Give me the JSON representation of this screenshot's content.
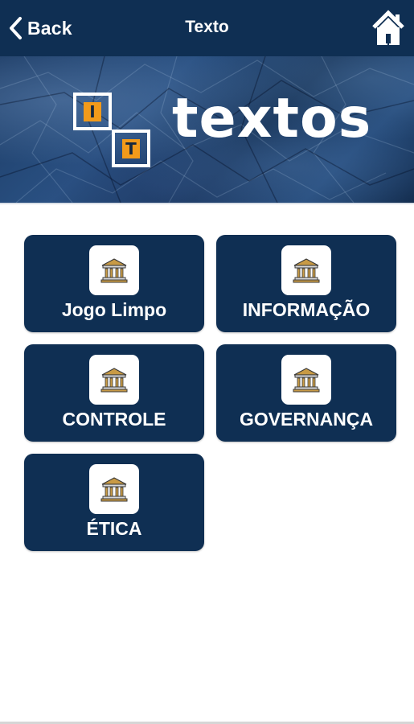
{
  "header": {
    "back_label": "Back",
    "title": "Texto",
    "back_icon": "chevron-left-icon",
    "home_icon": "home-icon"
  },
  "banner": {
    "logo_letters": [
      "I",
      "T"
    ],
    "text": "textos"
  },
  "tiles": [
    {
      "label": "Jogo Limpo",
      "icon": "bank-icon"
    },
    {
      "label": "INFORMAÇÃO",
      "icon": "bank-icon"
    },
    {
      "label": "CONTROLE",
      "icon": "bank-icon"
    },
    {
      "label": "GOVERNANÇA",
      "icon": "bank-icon"
    },
    {
      "label": "ÉTICA",
      "icon": "bank-icon"
    }
  ],
  "colors": {
    "navy": "#0f2f53",
    "accent_orange": "#f29a1a",
    "icon_gold": "#c89a45"
  }
}
